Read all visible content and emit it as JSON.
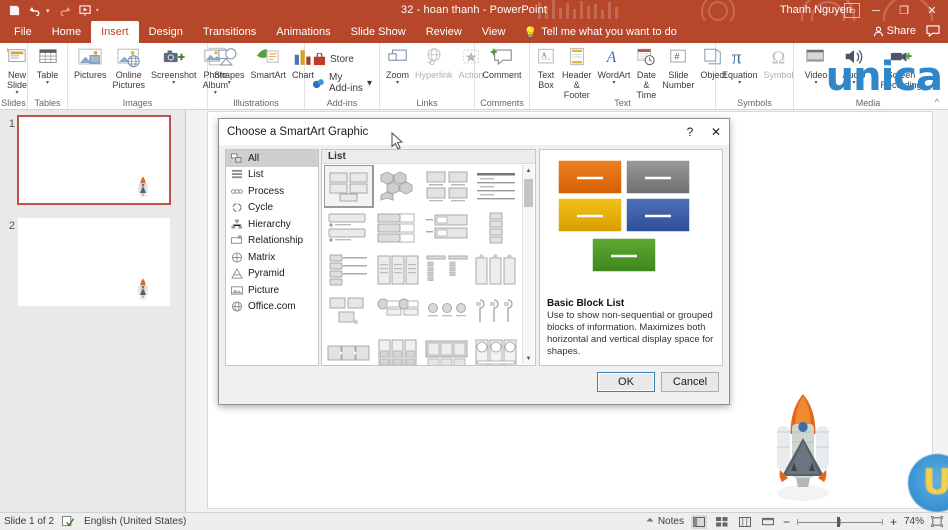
{
  "titlebar": {
    "title": "32 - hoan thanh  -  PowerPoint",
    "account": "Thanh Nguyen",
    "quick_access": [
      {
        "name": "save-icon",
        "glyph": "💾"
      },
      {
        "name": "undo-icon",
        "glyph": "↶"
      },
      {
        "name": "redo-icon",
        "glyph": "↻"
      },
      {
        "name": "start-presentation-icon",
        "glyph": "▷"
      },
      {
        "name": "customize-qat-icon",
        "glyph": "▾"
      }
    ],
    "ribbon_display_options": "⬚",
    "window_buttons": [
      {
        "name": "minimize-button",
        "glyph": "─"
      },
      {
        "name": "restore-button",
        "glyph": "❐"
      },
      {
        "name": "close-button",
        "glyph": "✕"
      }
    ]
  },
  "tabs": [
    {
      "label": "File",
      "active": false
    },
    {
      "label": "Home",
      "active": false
    },
    {
      "label": "Insert",
      "active": true
    },
    {
      "label": "Design",
      "active": false
    },
    {
      "label": "Transitions",
      "active": false
    },
    {
      "label": "Animations",
      "active": false
    },
    {
      "label": "Slide Show",
      "active": false
    },
    {
      "label": "Review",
      "active": false
    },
    {
      "label": "View",
      "active": false
    }
  ],
  "tellme": "Tell me what you want to do",
  "share": "Share",
  "ribbon": {
    "groups": [
      {
        "name": "Slides",
        "items": [
          {
            "label": "New\nSlide",
            "icon": "new-slide-icon",
            "caret": true
          }
        ]
      },
      {
        "name": "Tables",
        "items": [
          {
            "label": "Table",
            "icon": "table-icon",
            "caret": true
          }
        ]
      },
      {
        "name": "Images",
        "items": [
          {
            "label": "Pictures",
            "icon": "pictures-icon",
            "caret": false
          },
          {
            "label": "Online\nPictures",
            "icon": "online-pictures-icon",
            "caret": false
          },
          {
            "label": "Screenshot",
            "icon": "screenshot-icon",
            "caret": true
          },
          {
            "label": "Photo\nAlbum",
            "icon": "photo-album-icon",
            "caret": true
          }
        ]
      },
      {
        "name": "Illustrations",
        "items": [
          {
            "label": "Shapes",
            "icon": "shapes-icon",
            "caret": true
          },
          {
            "label": "SmartArt",
            "icon": "smartart-icon",
            "caret": false
          },
          {
            "label": "Chart",
            "icon": "chart-icon",
            "caret": false
          }
        ]
      },
      {
        "name": "Add-ins",
        "items": [
          {
            "label": "Store",
            "icon": "store-icon",
            "caret": false
          },
          {
            "label": "My Add-ins",
            "icon": "my-addins-icon",
            "caret": true
          }
        ]
      },
      {
        "name": "Links",
        "items": [
          {
            "label": "Zoom",
            "icon": "zoom-icon",
            "caret": true
          },
          {
            "label": "Hyperlink",
            "icon": "hyperlink-icon",
            "caret": false,
            "disabled": true
          },
          {
            "label": "Action",
            "icon": "action-icon",
            "caret": false,
            "disabled": true
          }
        ]
      },
      {
        "name": "Comments",
        "items": [
          {
            "label": "Comment",
            "icon": "comment-icon",
            "caret": false
          }
        ]
      },
      {
        "name": "Text",
        "items": [
          {
            "label": "Text\nBox",
            "icon": "text-box-icon",
            "caret": false
          },
          {
            "label": "Header\n& Footer",
            "icon": "header-footer-icon",
            "caret": false
          },
          {
            "label": "WordArt",
            "icon": "wordart-icon",
            "caret": true
          },
          {
            "label": "Date &\nTime",
            "icon": "date-time-icon",
            "caret": false
          },
          {
            "label": "Slide\nNumber",
            "icon": "slide-number-icon",
            "caret": false
          },
          {
            "label": "Object",
            "icon": "object-icon",
            "caret": false
          }
        ]
      },
      {
        "name": "Symbols",
        "items": [
          {
            "label": "Equation",
            "icon": "equation-icon",
            "caret": true
          },
          {
            "label": "Symbol",
            "icon": "symbol-icon",
            "caret": false,
            "disabled": true
          }
        ]
      },
      {
        "name": "Media",
        "items": [
          {
            "label": "Video",
            "icon": "video-icon",
            "caret": true
          },
          {
            "label": "Audio",
            "icon": "audio-icon",
            "caret": true
          },
          {
            "label": "Screen\nRecording",
            "icon": "screen-recording-icon",
            "caret": false
          }
        ]
      }
    ]
  },
  "slides_panel": {
    "slides": [
      {
        "number": "1",
        "selected": true
      },
      {
        "number": "2",
        "selected": false
      }
    ]
  },
  "dialog": {
    "title": "Choose a SmartArt Graphic",
    "help_glyph": "?",
    "close_glyph": "✕",
    "categories": [
      {
        "label": "All",
        "icon": "all-icon",
        "selected": true
      },
      {
        "label": "List",
        "icon": "list-icon",
        "selected": false
      },
      {
        "label": "Process",
        "icon": "process-icon",
        "selected": false
      },
      {
        "label": "Cycle",
        "icon": "cycle-icon",
        "selected": false
      },
      {
        "label": "Hierarchy",
        "icon": "hierarchy-icon",
        "selected": false
      },
      {
        "label": "Relationship",
        "icon": "relationship-icon",
        "selected": false
      },
      {
        "label": "Matrix",
        "icon": "matrix-icon",
        "selected": false
      },
      {
        "label": "Pyramid",
        "icon": "pyramid-icon",
        "selected": false
      },
      {
        "label": "Picture",
        "icon": "picture-icon",
        "selected": false
      },
      {
        "label": "Office.com",
        "icon": "office-com-icon",
        "selected": false
      }
    ],
    "gallery_header": "List",
    "preview": {
      "name": "Basic Block List",
      "description": "Use to show non-sequential or grouped blocks of information. Maximizes both horizontal and vertical display space for shapes.",
      "block_colors": [
        "#E0690B",
        "#808080",
        "#E8B000",
        "#3B5EA8",
        "#4E9A27"
      ]
    },
    "buttons": {
      "ok": "OK",
      "cancel": "Cancel"
    }
  },
  "statusbar": {
    "slide_indicator": "Slide 1 of 2",
    "language": "English (United States)",
    "notes": "Notes",
    "zoom_level": "74%",
    "view_buttons": [
      {
        "name": "normal-view-button",
        "active": true
      },
      {
        "name": "slide-sorter-button",
        "active": false
      },
      {
        "name": "reading-view-button",
        "active": false
      },
      {
        "name": "slide-show-button",
        "active": false
      }
    ],
    "zoom_out": "−",
    "zoom_in": "+",
    "fit-slide": "⛶"
  },
  "watermark": {
    "ribbon_text": "unica",
    "badge_letter": "U",
    "brand_color": "#2f86c8",
    "badge_letter_color": "#f5d04e"
  }
}
